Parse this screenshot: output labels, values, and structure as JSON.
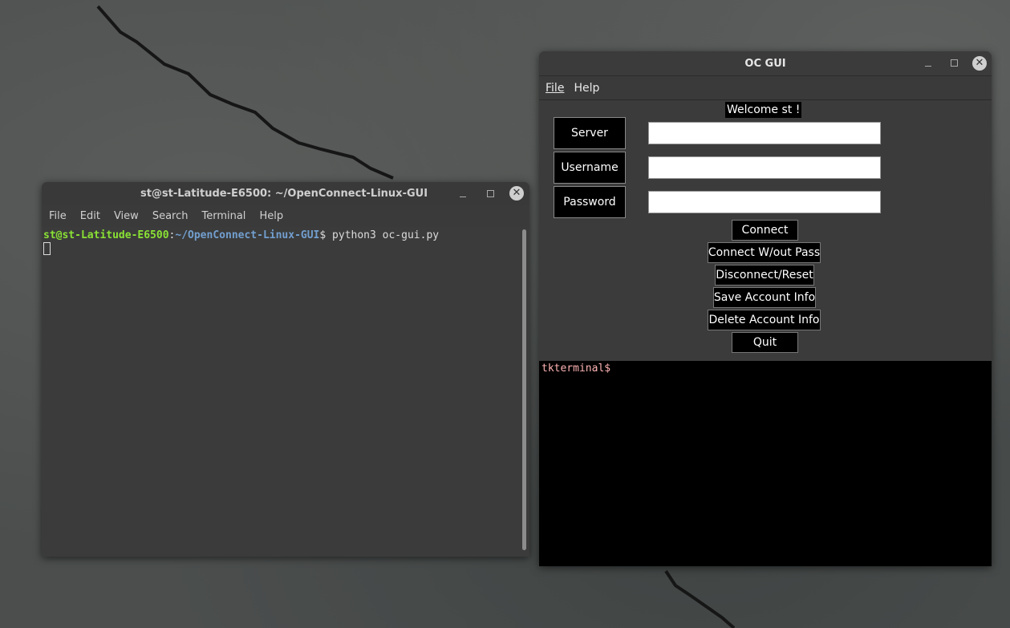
{
  "terminal": {
    "title": "st@st-Latitude-E6500: ~/OpenConnect-Linux-GUI",
    "menu": [
      "File",
      "Edit",
      "View",
      "Search",
      "Terminal",
      "Help"
    ],
    "prompt_user": "st@st-Latitude-E6500",
    "prompt_sep": ":",
    "prompt_path": "~/OpenConnect-Linux-GUI",
    "prompt_symbol": "$",
    "command": " python3 oc-gui.py"
  },
  "oc_gui": {
    "title": "OC GUI",
    "menu": [
      "File",
      "Help"
    ],
    "welcome": "Welcome st !",
    "fields": {
      "server_label": "Server",
      "username_label": "Username",
      "password_label": "Password",
      "server_value": "",
      "username_value": "",
      "password_value": ""
    },
    "buttons": {
      "connect": "Connect",
      "connect_without_pass": "Connect W/out Pass",
      "disconnect": "Disconnect/Reset",
      "save": "Save Account Info",
      "delete": "Delete Account Info",
      "quit": "Quit"
    },
    "console_prompt": "tkterminal$"
  },
  "icons": {
    "minimize": "minimize-icon",
    "maximize": "maximize-icon",
    "close": "close-icon"
  },
  "colors": {
    "prompt_user": "#8ae234",
    "prompt_path": "#729fcf",
    "console_text": "#ffb3b3"
  }
}
